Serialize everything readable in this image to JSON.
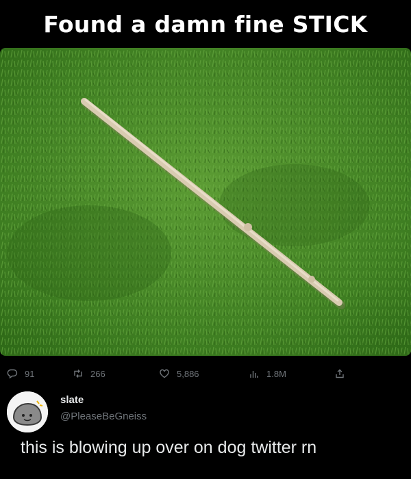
{
  "headline": "Found a damn fine STICK",
  "photo": {
    "icon": "stick-on-grass-photo",
    "grass_color": "#4a8a2a",
    "stick_color": "#d9cbb1"
  },
  "actions": {
    "replies": "91",
    "retweets": "266",
    "likes": "5,886",
    "views": "1.8M"
  },
  "author": {
    "name": "slate",
    "handle": "@PleaseBeGneiss",
    "avatar_icon": "rock-face-avatar"
  },
  "tweet_text": "this is blowing up over on dog twitter rn",
  "colors": {
    "background": "#000000",
    "muted": "#71767b",
    "text": "#e7e9ea"
  }
}
